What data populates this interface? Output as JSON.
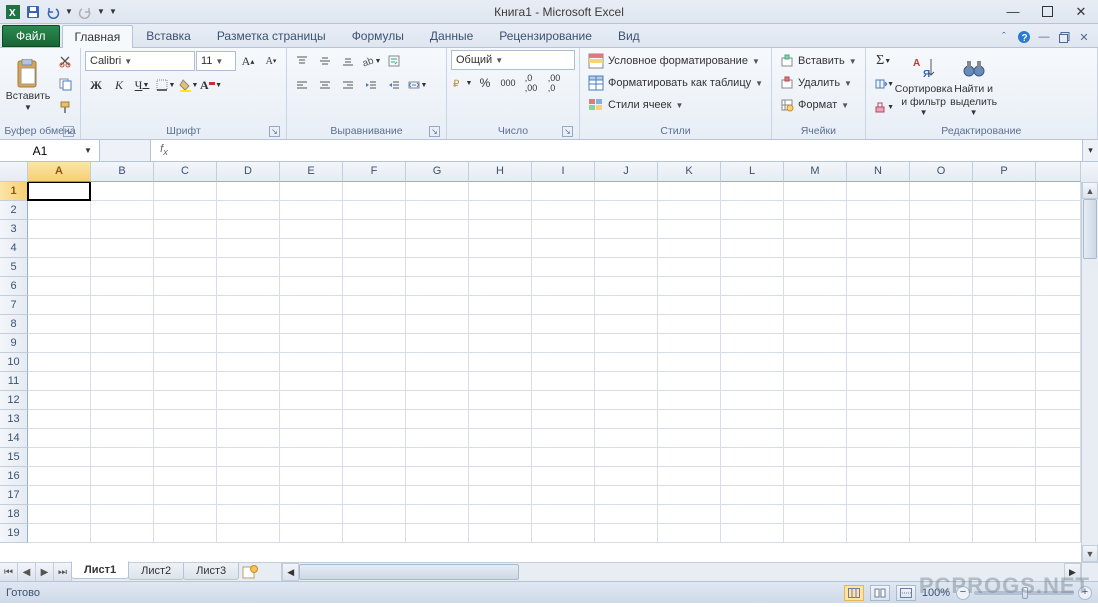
{
  "title": "Книга1  -  Microsoft Excel",
  "tabs": {
    "file": "Файл",
    "items": [
      "Главная",
      "Вставка",
      "Разметка страницы",
      "Формулы",
      "Данные",
      "Рецензирование",
      "Вид"
    ],
    "active": 0
  },
  "ribbon": {
    "clipboard": {
      "paste": "Вставить",
      "label": "Буфер обмена"
    },
    "font": {
      "name": "Calibri",
      "size": "11",
      "label": "Шрифт"
    },
    "alignment": {
      "label": "Выравнивание"
    },
    "number": {
      "format": "Общий",
      "label": "Число"
    },
    "styles": {
      "cond": "Условное форматирование",
      "table": "Форматировать как таблицу",
      "cell": "Стили ячеек",
      "label": "Стили"
    },
    "cells": {
      "insert": "Вставить",
      "delete": "Удалить",
      "format": "Формат",
      "label": "Ячейки"
    },
    "editing": {
      "sort": "Сортировка\nи фильтр",
      "find": "Найти и\nвыделить",
      "label": "Редактирование"
    }
  },
  "namebox": "A1",
  "columns": [
    "A",
    "B",
    "C",
    "D",
    "E",
    "F",
    "G",
    "H",
    "I",
    "J",
    "K",
    "L",
    "M",
    "N",
    "O",
    "P"
  ],
  "rows": [
    "1",
    "2",
    "3",
    "4",
    "5",
    "6",
    "7",
    "8",
    "9",
    "10",
    "11",
    "12",
    "13",
    "14",
    "15",
    "16",
    "17",
    "18",
    "19"
  ],
  "selected": {
    "col": 0,
    "row": 0
  },
  "sheets": {
    "items": [
      "Лист1",
      "Лист2",
      "Лист3"
    ],
    "active": 0
  },
  "status": {
    "ready": "Готово",
    "zoom": "100%"
  },
  "watermark": "PCPROGS.NET"
}
